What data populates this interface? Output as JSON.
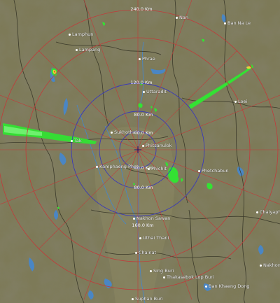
{
  "radar": {
    "range_rings": [
      {
        "label": "40.0 Km"
      },
      {
        "label": "80.0 Km"
      },
      {
        "label": "120.0 Km"
      },
      {
        "label": "160.0 Km"
      },
      {
        "label": "240.0 Km"
      }
    ],
    "lower_ring_labels": [
      {
        "label": "40.0 Km"
      },
      {
        "label": "80.0 Km"
      },
      {
        "label": "160.0 Km"
      }
    ]
  },
  "cities": [
    {
      "id": "nan",
      "label": "Nan"
    },
    {
      "id": "ban-na-le",
      "label": "Ban Na Le"
    },
    {
      "id": "lamphun",
      "label": "Lamphun"
    },
    {
      "id": "lampang",
      "label": "Lampang"
    },
    {
      "id": "phrae",
      "label": "Phrae"
    },
    {
      "id": "uttaradit",
      "label": "Uttaradit"
    },
    {
      "id": "loei",
      "label": "Loei"
    },
    {
      "id": "sukhothai",
      "label": "Sukhothai"
    },
    {
      "id": "tak",
      "label": "Tak"
    },
    {
      "id": "phitsanulok",
      "label": "Phitsanulok"
    },
    {
      "id": "kamphaeng-phet",
      "label": "Kamphaeng Phet"
    },
    {
      "id": "phichit",
      "label": "Phichit"
    },
    {
      "id": "phetchabun",
      "label": "Phetchabun"
    },
    {
      "id": "chaiyaphum",
      "label": "Chaiyaphum"
    },
    {
      "id": "nakhon-sawan",
      "label": "Nakhon Sawan"
    },
    {
      "id": "uthai-thani",
      "label": "Uthai Thani"
    },
    {
      "id": "chainat",
      "label": "Chainat"
    },
    {
      "id": "sing-buri",
      "label": "Sing Buri"
    },
    {
      "id": "thakasebok-lop-buri",
      "label": "Thakasebok Lop Buri"
    },
    {
      "id": "ban-khaeng-dong",
      "label": "Ban Khaeng Dong"
    },
    {
      "id": "nakhon-ratchasima",
      "label": "Nakhon Ras"
    },
    {
      "id": "suphan-buri",
      "label": "Suphan Buri"
    }
  ],
  "colors": {
    "terrain": "#7d7a58",
    "water": "#4a86c4",
    "echo": "#33e233",
    "inner_rings": "#3a3ab8",
    "outer_rings": "#c23a3a",
    "borders": "#3b3a2a"
  }
}
